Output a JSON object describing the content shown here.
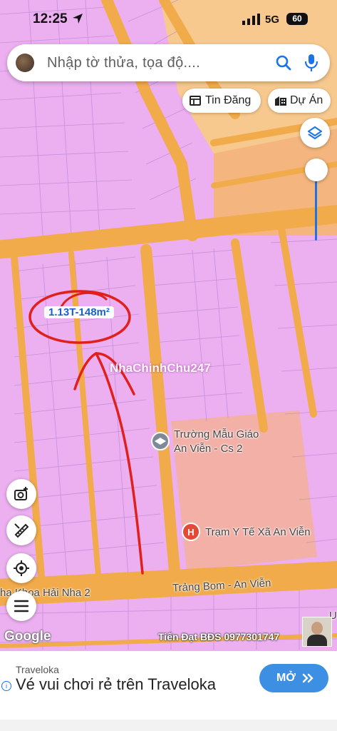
{
  "status": {
    "time": "12:25",
    "network": "5G",
    "battery": "60"
  },
  "search": {
    "placeholder": "Nhập tờ thửa, tọa độ...."
  },
  "chips": {
    "news": "Tin Đăng",
    "project": "Dự Án"
  },
  "map": {
    "parcel_label": "1.13T-148m²",
    "watermark": "NhaChinhChu247",
    "school_line1": "Trường Mẫu Giáo",
    "school_line2": "An Viễn - Cs 2",
    "clinic": "Trạm Y Tế Xã An Viễn",
    "road": "Trảng Bom - An Viễn",
    "dental": "ha Khoa Hải Nha 2",
    "edge_label": "U",
    "google": "Google",
    "credit": "Tiến Đạt BĐS 0977301747",
    "colors": {
      "residential": "#ecaff0",
      "road": "#f1ab4a",
      "public": "#f2b0a7",
      "commercial": "#f8c98f",
      "annotation": "#e0201c"
    }
  },
  "icons": {
    "location_arrow": "location-arrow-icon",
    "search": "search-icon",
    "mic": "mic-icon",
    "layers": "layers-icon",
    "camera": "camera-add-icon",
    "measure": "measure-icon",
    "locate": "my-location-icon",
    "menu": "menu-icon"
  },
  "ad": {
    "source": "Traveloka",
    "headline": "Vé vui chơi rẻ trên Traveloka",
    "cta": "MỞ"
  }
}
